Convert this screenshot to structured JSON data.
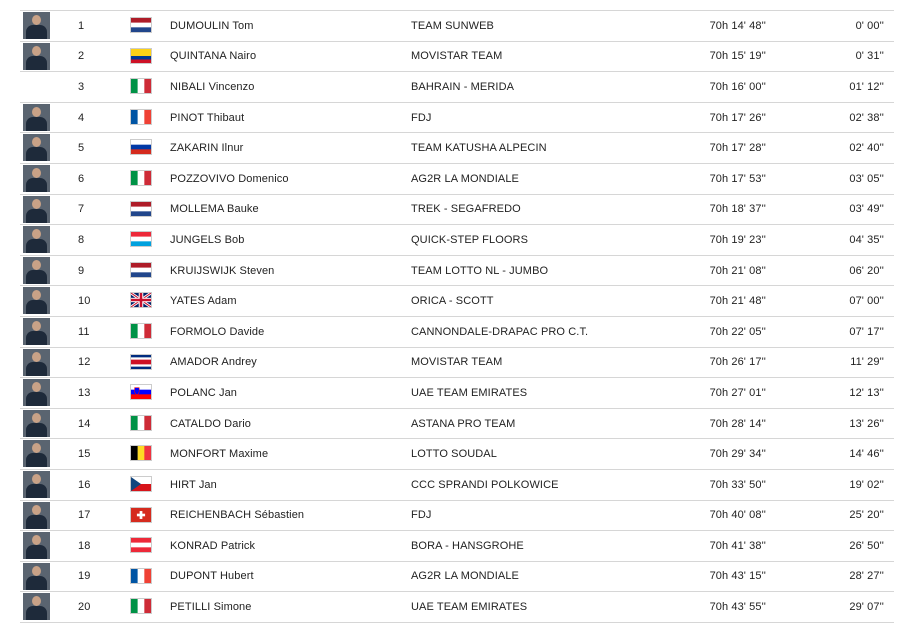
{
  "rows": [
    {
      "pos": "1",
      "name": "DUMOULIN Tom",
      "team": "TEAM SUNWEB",
      "time": "70h 14' 48''",
      "gap": "0' 00''",
      "flag": "nl",
      "photo": true
    },
    {
      "pos": "2",
      "name": "QUINTANA Nairo",
      "team": "MOVISTAR TEAM",
      "time": "70h 15' 19''",
      "gap": "0' 31''",
      "flag": "co",
      "photo": true
    },
    {
      "pos": "3",
      "name": "NIBALI Vincenzo",
      "team": "BAHRAIN - MERIDA",
      "time": "70h 16' 00''",
      "gap": "01' 12''",
      "flag": "it",
      "photo": false
    },
    {
      "pos": "4",
      "name": "PINOT Thibaut",
      "team": "FDJ",
      "time": "70h 17' 26''",
      "gap": "02' 38''",
      "flag": "fr",
      "photo": true
    },
    {
      "pos": "5",
      "name": "ZAKARIN Ilnur",
      "team": "TEAM KATUSHA ALPECIN",
      "time": "70h 17' 28''",
      "gap": "02' 40''",
      "flag": "ru",
      "photo": true
    },
    {
      "pos": "6",
      "name": "POZZOVIVO Domenico",
      "team": "AG2R LA MONDIALE",
      "time": "70h 17' 53''",
      "gap": "03' 05''",
      "flag": "it",
      "photo": true
    },
    {
      "pos": "7",
      "name": "MOLLEMA Bauke",
      "team": "TREK - SEGAFREDO",
      "time": "70h 18' 37''",
      "gap": "03' 49''",
      "flag": "nl",
      "photo": true
    },
    {
      "pos": "8",
      "name": "JUNGELS Bob",
      "team": "QUICK-STEP FLOORS",
      "time": "70h 19' 23''",
      "gap": "04' 35''",
      "flag": "lu",
      "photo": true
    },
    {
      "pos": "9",
      "name": "KRUIJSWIJK Steven",
      "team": "TEAM LOTTO NL - JUMBO",
      "time": "70h 21' 08''",
      "gap": "06' 20''",
      "flag": "nl",
      "photo": true
    },
    {
      "pos": "10",
      "name": "YATES Adam",
      "team": "ORICA - SCOTT",
      "time": "70h 21' 48''",
      "gap": "07' 00''",
      "flag": "gb",
      "photo": true
    },
    {
      "pos": "11",
      "name": "FORMOLO Davide",
      "team": "CANNONDALE-DRAPAC PRO C.T.",
      "time": "70h 22' 05''",
      "gap": "07' 17''",
      "flag": "it",
      "photo": true
    },
    {
      "pos": "12",
      "name": "AMADOR Andrey",
      "team": "MOVISTAR TEAM",
      "time": "70h 26' 17''",
      "gap": "11' 29''",
      "flag": "cr",
      "photo": true
    },
    {
      "pos": "13",
      "name": "POLANC Jan",
      "team": "UAE TEAM EMIRATES",
      "time": "70h 27' 01''",
      "gap": "12' 13''",
      "flag": "si",
      "photo": true
    },
    {
      "pos": "14",
      "name": "CATALDO Dario",
      "team": "ASTANA PRO TEAM",
      "time": "70h 28' 14''",
      "gap": "13' 26''",
      "flag": "it",
      "photo": true
    },
    {
      "pos": "15",
      "name": "MONFORT Maxime",
      "team": "LOTTO SOUDAL",
      "time": "70h 29' 34''",
      "gap": "14' 46''",
      "flag": "be",
      "photo": true
    },
    {
      "pos": "16",
      "name": "HIRT Jan",
      "team": "CCC SPRANDI POLKOWICE",
      "time": "70h 33' 50''",
      "gap": "19' 02''",
      "flag": "cz",
      "photo": true
    },
    {
      "pos": "17",
      "name": "REICHENBACH Sébastien",
      "team": "FDJ",
      "time": "70h 40' 08''",
      "gap": "25' 20''",
      "flag": "ch",
      "photo": true
    },
    {
      "pos": "18",
      "name": "KONRAD Patrick",
      "team": "BORA - HANSGROHE",
      "time": "70h 41' 38''",
      "gap": "26' 50''",
      "flag": "at",
      "photo": true
    },
    {
      "pos": "19",
      "name": "DUPONT Hubert",
      "team": "AG2R LA MONDIALE",
      "time": "70h 43' 15''",
      "gap": "28' 27''",
      "flag": "fr",
      "photo": true
    },
    {
      "pos": "20",
      "name": "PETILLI Simone",
      "team": "UAE TEAM EMIRATES",
      "time": "70h 43' 55''",
      "gap": "29' 07''",
      "flag": "it",
      "photo": true
    }
  ]
}
